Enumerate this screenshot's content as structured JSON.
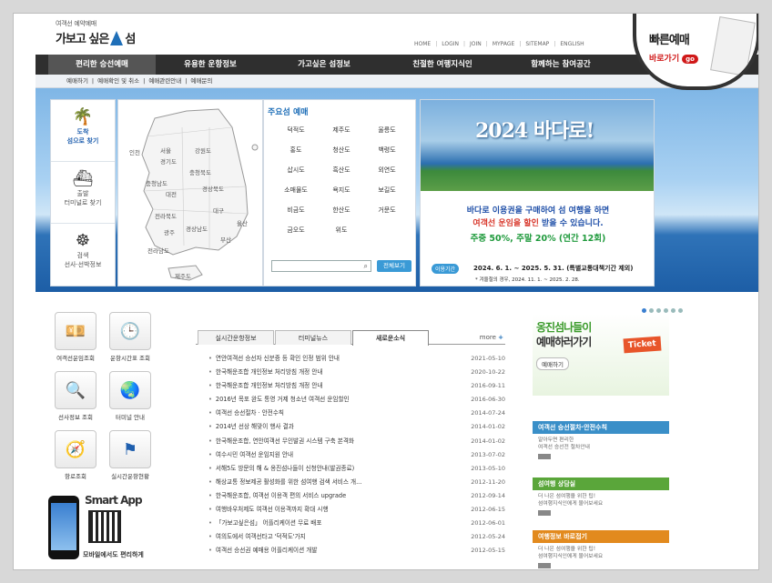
{
  "logo": {
    "sub": "여객선 예약예매",
    "main_left": "가보고 싶은",
    "main_right": "섬"
  },
  "top_links": [
    "HOME",
    "LOGIN",
    "JOIN",
    "MYPAGE",
    "SITEMAP",
    "ENGLISH"
  ],
  "quick_banner": {
    "title": "빠른예매",
    "sub": "바로가기",
    "go": "go"
  },
  "gnb": [
    "편리한 승선예매",
    "유용한 운항정보",
    "가고싶은 섬정보",
    "친절한 여행지식인",
    "함께하는 참여공간"
  ],
  "lnb": [
    "예매하기",
    "예매확인 및 취소",
    "예매관련안내",
    "예매문의"
  ],
  "left_nav": [
    {
      "l1": "도착",
      "l2": "섬으로 찾기"
    },
    {
      "l1": "출발",
      "l2": "터미널로 찾기"
    },
    {
      "l1": "검색",
      "l2": "선사·선박정보"
    }
  ],
  "map_regions": [
    "인천",
    "서울",
    "경기도",
    "강원도",
    "충청북도",
    "충청남도",
    "대전",
    "경상북도",
    "대구",
    "울산",
    "전라북도",
    "경상남도",
    "광주",
    "부산",
    "전라남도",
    "제주도"
  ],
  "islands": {
    "title": "주요섬 예매",
    "list": [
      "덕적도",
      "제주도",
      "울릉도",
      "홍도",
      "청산도",
      "백령도",
      "삽시도",
      "흑산도",
      "외연도",
      "소매물도",
      "욕지도",
      "보길도",
      "비금도",
      "한산도",
      "거문도",
      "금오도",
      "위도"
    ],
    "search_button": "전체보기"
  },
  "banner": {
    "headline": "2024 바다로!",
    "line1": "바다로 이용권을 구매하여 섬 여행을 하면",
    "line2_red": "여객선 운임을 할인",
    "line2_rest": "받을 수 있습니다.",
    "line3": "주중 50%, 주말 20% (연간 12회)",
    "period_label": "이용기간",
    "dates": "2024. 6. 1. ~ 2025. 5. 31. (특별교통대책기간 제외)",
    "note": "* 겨울철의 경우, 2024. 11. 1. ~ 2025. 2. 28."
  },
  "quick_menu": [
    "여객선운임조회",
    "운항시간표 조회",
    "선사정보 조회",
    "터미널 안내",
    "항로조회",
    "실시간운항현황"
  ],
  "smart_app": {
    "title": "Smart App",
    "caption": "모바일에서도 편리하게"
  },
  "news": {
    "tabs": [
      "실시간운항정보",
      "터미널뉴스",
      "새로운소식"
    ],
    "active_tab": 2,
    "more": "more",
    "items": [
      {
        "title": "연안여객선 승선자 신분증 등 확인 인정 범위 안내",
        "date": "2021-05-10"
      },
      {
        "title": "한국해운조합 개인정보 처리방침 개정 안내",
        "date": "2020-10-22"
      },
      {
        "title": "한국해운조합 개인정보 처리방침 개정 안내",
        "date": "2016-09-11"
      },
      {
        "title": "2016년 목포 완도 통영 거제 청소년 여객선 운임할인",
        "date": "2016-06-30"
      },
      {
        "title": "여객선 승선절차 · 안전수칙",
        "date": "2014-07-24"
      },
      {
        "title": "2014년 선상 해맞이 행사 결과",
        "date": "2014-01-02"
      },
      {
        "title": "한국해운조합, 연안여객선 무인발권 시스템 구축 본격화",
        "date": "2014-01-02"
      },
      {
        "title": "여수시민 여객선 운임지원 안내",
        "date": "2013-07-02"
      },
      {
        "title": "서해5도 방문의 해 & 옹진섬나들이 신청안내(발권종료)",
        "date": "2013-05-10"
      },
      {
        "title": "해상교통 정보제공 활성화를 위한 섬여행 검색 서비스 개...",
        "date": "2012-11-20"
      },
      {
        "title": "한국해운조합, 여객선 이용객 편의 서비스 upgrade",
        "date": "2012-09-14"
      },
      {
        "title": "여행바우처제도 여객선 이용객까지 확대 시행",
        "date": "2012-06-15"
      },
      {
        "title": "「가보고싶은섬」 어플리케이션 무료 배포",
        "date": "2012-06-01"
      },
      {
        "title": "여의도에서 여객선타고 '덕적도'가지",
        "date": "2012-05-24"
      },
      {
        "title": "여객선 승선권 예매용 어플리케이션 개발",
        "date": "2012-05-15"
      }
    ]
  },
  "side": {
    "promo_a": "옹진섬나들이",
    "promo_b": "예매하러가기",
    "promo_c": "예매하기",
    "ticket": "Ticket",
    "cards": [
      {
        "title": "여객선 승선절차·안전수칙",
        "text1": "알아두면 편리한",
        "text2": "여객선 승선전 절차안내",
        "color": "#3a8fc8"
      },
      {
        "title": "섬여행 상담실",
        "text1": "더 나은 섬여행을 위한 팁!",
        "text2": "섬여행지식인에게 물어보세요",
        "color": "#5aa63a"
      },
      {
        "title": "여행정보 바로접기",
        "text1": "더 나은 섬여행을 위한 팁!",
        "text2": "섬여행지식인에게 물어보세요",
        "color": "#e28a1e"
      }
    ]
  },
  "colors": {
    "gnb_bg": "#2f2f2f",
    "accent_blue": "#1f6fb8",
    "accent_red": "#d01818"
  }
}
